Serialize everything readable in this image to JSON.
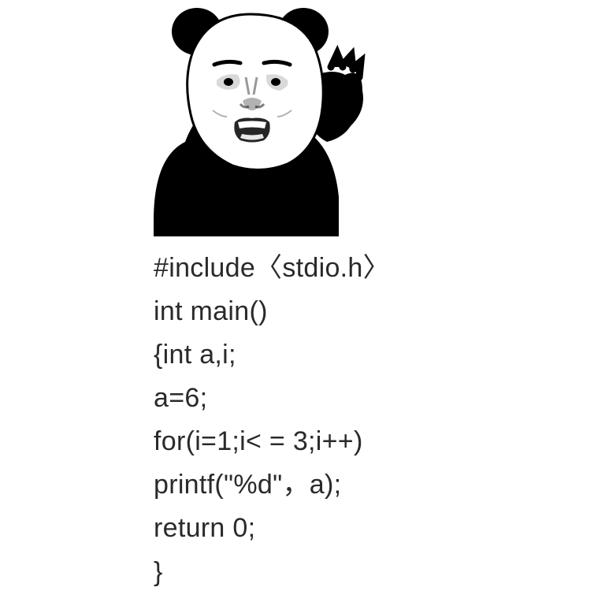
{
  "code": {
    "line1": "#include〈stdio.h〉",
    "line2": "int main()",
    "line3": "{int a,i;",
    "line4": "a=6;",
    "line5": "for(i=1;i< = 3;i++)",
    "line6": "printf(\"%d\"，a);",
    "line7": "return 0;",
    "line8": "}"
  }
}
